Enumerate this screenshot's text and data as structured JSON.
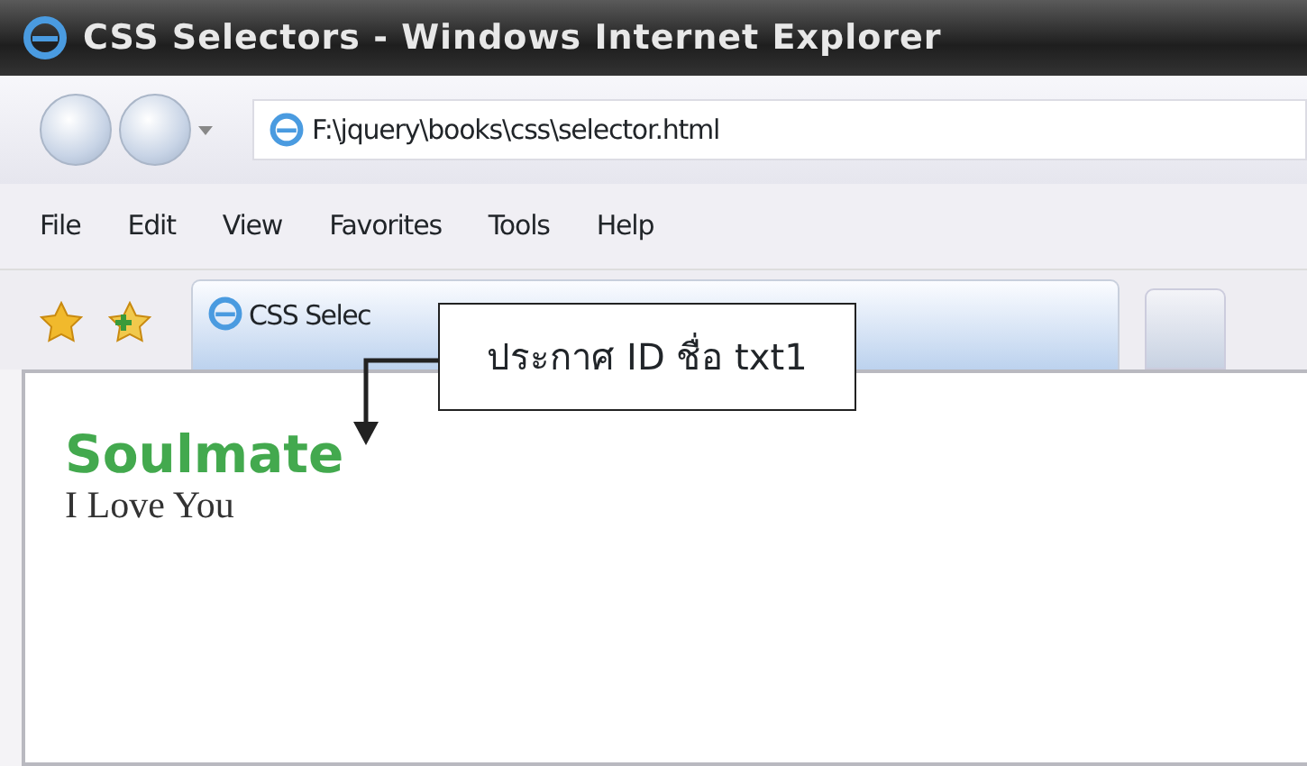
{
  "window": {
    "title": "CSS Selectors - Windows Internet Explorer"
  },
  "address_bar": {
    "value": "F:\\jquery\\books\\css\\selector.html"
  },
  "menu": [
    "File",
    "Edit",
    "View",
    "Favorites",
    "Tools",
    "Help"
  ],
  "tabs": [
    {
      "label": "CSS Selec",
      "selected": true
    }
  ],
  "page": {
    "heading": "Soulmate",
    "text": "I Love You"
  },
  "callout": {
    "text": "ประกาศ ID ชื่อ txt1"
  }
}
